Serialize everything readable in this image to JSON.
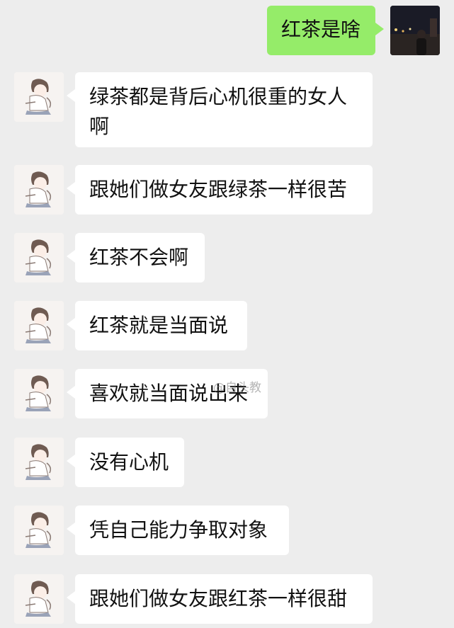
{
  "chat": {
    "outgoing": {
      "text": "红茶是啥",
      "avatar_icon": "night-street-photo-avatar"
    },
    "incoming_avatar_icon": "cartoon-boy-avatar",
    "messages": [
      {
        "text": "绿茶都是背后心机很重的女人\n啊"
      },
      {
        "text": "跟她们做女友跟绿茶一样很苦"
      },
      {
        "text": "红茶不会啊"
      },
      {
        "text": "红茶就是当面说"
      },
      {
        "text": "喜欢就当面说出来"
      },
      {
        "text": "没有心机"
      },
      {
        "text": "凭自己能力争取对象"
      },
      {
        "text": "跟她们做女友跟红茶一样很甜"
      }
    ]
  },
  "watermark": {
    "text": "@自头教"
  }
}
